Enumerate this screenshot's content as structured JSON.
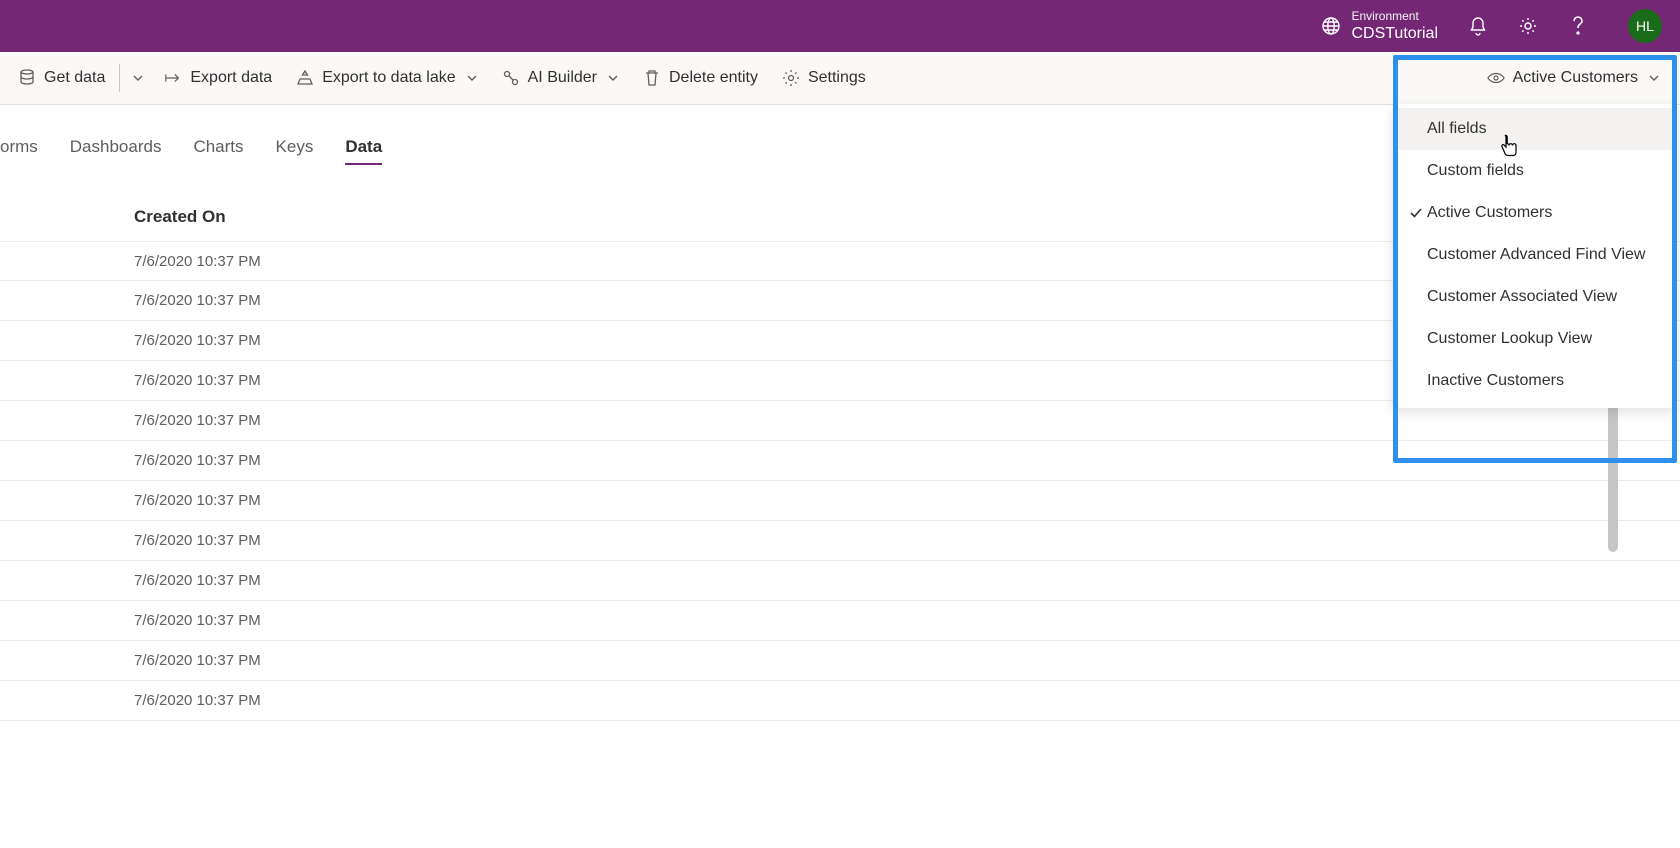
{
  "header": {
    "env_label": "Environment",
    "env_name": "CDSTutorial",
    "avatar_initials": "HL"
  },
  "commands": {
    "get_data": "Get data",
    "export_data": "Export data",
    "export_data_lake": "Export to data lake",
    "ai_builder": "AI Builder",
    "delete_entity": "Delete entity",
    "settings": "Settings"
  },
  "view_selector": {
    "current": "Active Customers",
    "options": [
      {
        "label": "All fields",
        "checked": false
      },
      {
        "label": "Custom fields",
        "checked": false
      },
      {
        "label": "Active Customers",
        "checked": true
      },
      {
        "label": "Customer Advanced Find View",
        "checked": false
      },
      {
        "label": "Customer Associated View",
        "checked": false
      },
      {
        "label": "Customer Lookup View",
        "checked": false
      },
      {
        "label": "Inactive Customers",
        "checked": false
      }
    ]
  },
  "tabs": [
    {
      "label": "orms",
      "active": false
    },
    {
      "label": "Dashboards",
      "active": false
    },
    {
      "label": "Charts",
      "active": false
    },
    {
      "label": "Keys",
      "active": false
    },
    {
      "label": "Data",
      "active": true
    }
  ],
  "table": {
    "column_header": "Created On",
    "rows": [
      "7/6/2020 10:37 PM",
      "7/6/2020 10:37 PM",
      "7/6/2020 10:37 PM",
      "7/6/2020 10:37 PM",
      "7/6/2020 10:37 PM",
      "7/6/2020 10:37 PM",
      "7/6/2020 10:37 PM",
      "7/6/2020 10:37 PM",
      "7/6/2020 10:37 PM",
      "7/6/2020 10:37 PM",
      "7/6/2020 10:37 PM",
      "7/6/2020 10:37 PM"
    ]
  }
}
